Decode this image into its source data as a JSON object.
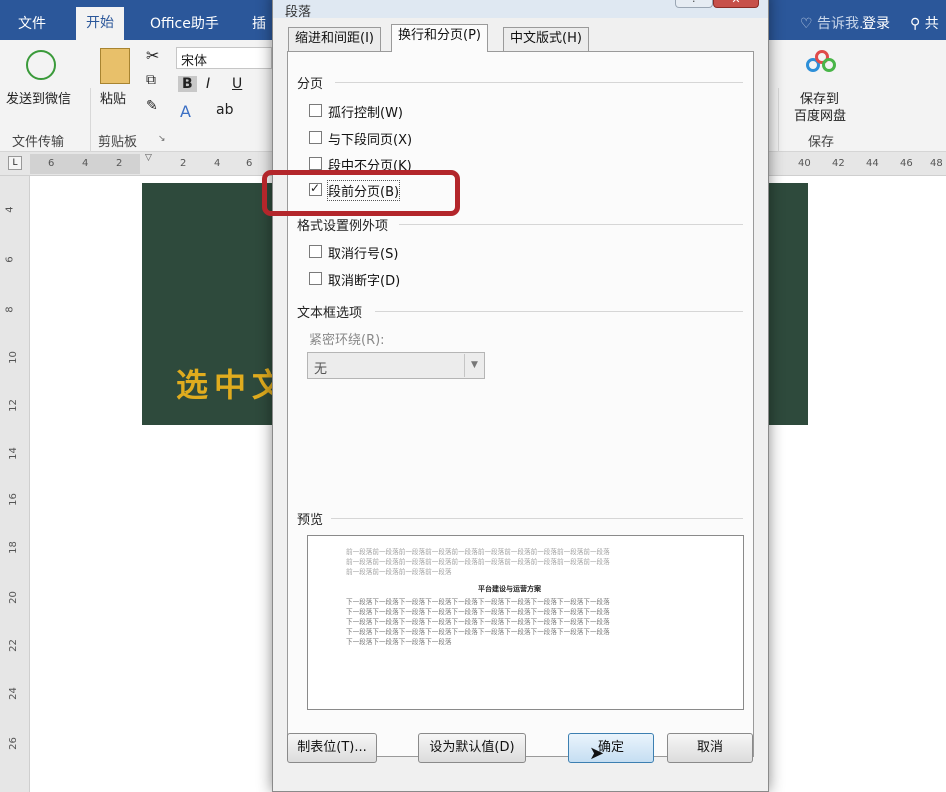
{
  "word": {
    "tabs": [
      "文件",
      "开始",
      "Office助手",
      "插"
    ],
    "active_tab": "开始",
    "tell_me": "告诉我...",
    "login": "登录",
    "share": "共",
    "groups": {
      "wechat_btn": "发送到微信",
      "file_transfer": "文件传输",
      "paste_btn": "粘贴",
      "clipboard": "剪贴板",
      "font_name": "宋体",
      "save_to": "保存到",
      "baidu_disk": "百度网盘",
      "save_group": "保存"
    },
    "hruler_numbers": [
      "6",
      "4",
      "2",
      "2",
      "4",
      "6",
      "40",
      "42",
      "44",
      "46",
      "48"
    ],
    "vruler_numbers": [
      "4",
      "6",
      "8",
      "10",
      "12",
      "14",
      "16",
      "18",
      "20",
      "22",
      "24",
      "26"
    ],
    "doc_text": "选中文"
  },
  "dialog": {
    "title": "段落",
    "help": "?",
    "close": "✕",
    "tabs": [
      "缩进和间距(I)",
      "换行和分页(P)",
      "中文版式(H)"
    ],
    "active_tab": "换行和分页(P)",
    "pagination": {
      "heading": "分页",
      "options": [
        {
          "label": "孤行控制(W)",
          "checked": false
        },
        {
          "label": "与下段同页(X)",
          "checked": false
        },
        {
          "label": "段中不分页(K)",
          "checked": false
        },
        {
          "label": "段前分页(B)",
          "checked": true
        }
      ]
    },
    "exceptions": {
      "heading": "格式设置例外项",
      "options": [
        {
          "label": "取消行号(S)",
          "checked": false
        },
        {
          "label": "取消断字(D)",
          "checked": false
        }
      ]
    },
    "textbox": {
      "heading": "文本框选项",
      "wrap_label": "紧密环绕(R):",
      "wrap_value": "无"
    },
    "preview": {
      "heading": "预览",
      "prev_lines": [
        "前一段落前一段落前一段落前一段落前一段落前一段落前一段落前一段落前一段落前一段落",
        "前一段落前一段落前一段落前一段落前一段落前一段落前一段落前一段落前一段落前一段落",
        "前一段落前一段落前一段落前一段落"
      ],
      "current": "平台建设与运营方案",
      "next_lines": [
        "下一段落下一段落下一段落下一段落下一段落下一段落下一段落下一段落下一段落下一段落",
        "下一段落下一段落下一段落下一段落下一段落下一段落下一段落下一段落下一段落下一段落",
        "下一段落下一段落下一段落下一段落下一段落下一段落下一段落下一段落下一段落下一段落",
        "下一段落下一段落下一段落下一段落下一段落下一段落下一段落下一段落下一段落下一段落",
        "下一段落下一段落下一段落下一段落"
      ]
    },
    "buttons": {
      "tabs": "制表位(T)...",
      "set_default": "设为默认值(D)",
      "ok": "确定",
      "cancel": "取消"
    }
  },
  "colors": {
    "word_blue": "#2b579a",
    "green_box": "#2e4a3c",
    "gold_text": "#e0ac1e",
    "highlight_red": "#b3262b"
  }
}
